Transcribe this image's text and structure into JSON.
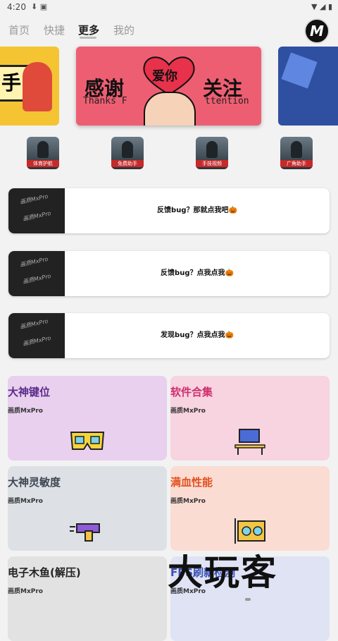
{
  "status_bar": {
    "time": "4:20",
    "left_icons": "⬇ ▣",
    "right_icons": "▼ ◢ ▮"
  },
  "tabs": [
    {
      "label": "首页",
      "active": false
    },
    {
      "label": "快捷",
      "active": false
    },
    {
      "label": "更多",
      "active": true
    },
    {
      "label": "我的",
      "active": false
    }
  ],
  "logo_letter": "M",
  "banner": {
    "left_char": "手",
    "main_left": "感谢",
    "main_right": "关注",
    "heart_text": "爱你",
    "sub_left": "Thanks F",
    "sub_right": "ttention"
  },
  "game_icons": [
    {
      "label": "体育护航"
    },
    {
      "label": "免费助手"
    },
    {
      "label": "手技视频"
    },
    {
      "label": "广角助手"
    }
  ],
  "feedback_cards": [
    {
      "text": "反馈bug？那就点我吧🎃",
      "thumb": "画质MxPro"
    },
    {
      "text": "反馈bug？点我点我🎃",
      "thumb": "画质MxPro"
    },
    {
      "text": "发现bug？点我点我🎃",
      "thumb": "画质MxPro"
    }
  ],
  "tiles": [
    {
      "title": "大神键位",
      "subtitle": "画质MxPro",
      "bg": "#e8d0ee",
      "color": "#5b2a8a",
      "icon": "vr-glasses-icon"
    },
    {
      "title": "软件合集",
      "subtitle": "画质MxPro",
      "bg": "#f8d3e0",
      "color": "#cc2f6e",
      "icon": "desk-computer-icon"
    },
    {
      "title": "大神灵敏度",
      "subtitle": "画质MxPro",
      "bg": "#dde1e6",
      "color": "#3d4652",
      "icon": "blaster-gun-icon"
    },
    {
      "title": "满血性能",
      "subtitle": "画质MxPro",
      "bg": "#fbdcd3",
      "color": "#e0511f",
      "icon": "graphics-card-icon"
    },
    {
      "title": "电子木鱼(解压)",
      "subtitle": "画质MxPro",
      "bg": "#e2e2e2",
      "color": "#222222",
      "icon": ""
    },
    {
      "title": "FPS刷新检测",
      "subtitle": "画质MxPro",
      "bg": "#dfe3f4",
      "color": "#3b4fb3",
      "icon": ""
    }
  ],
  "watermark": "大玩客"
}
